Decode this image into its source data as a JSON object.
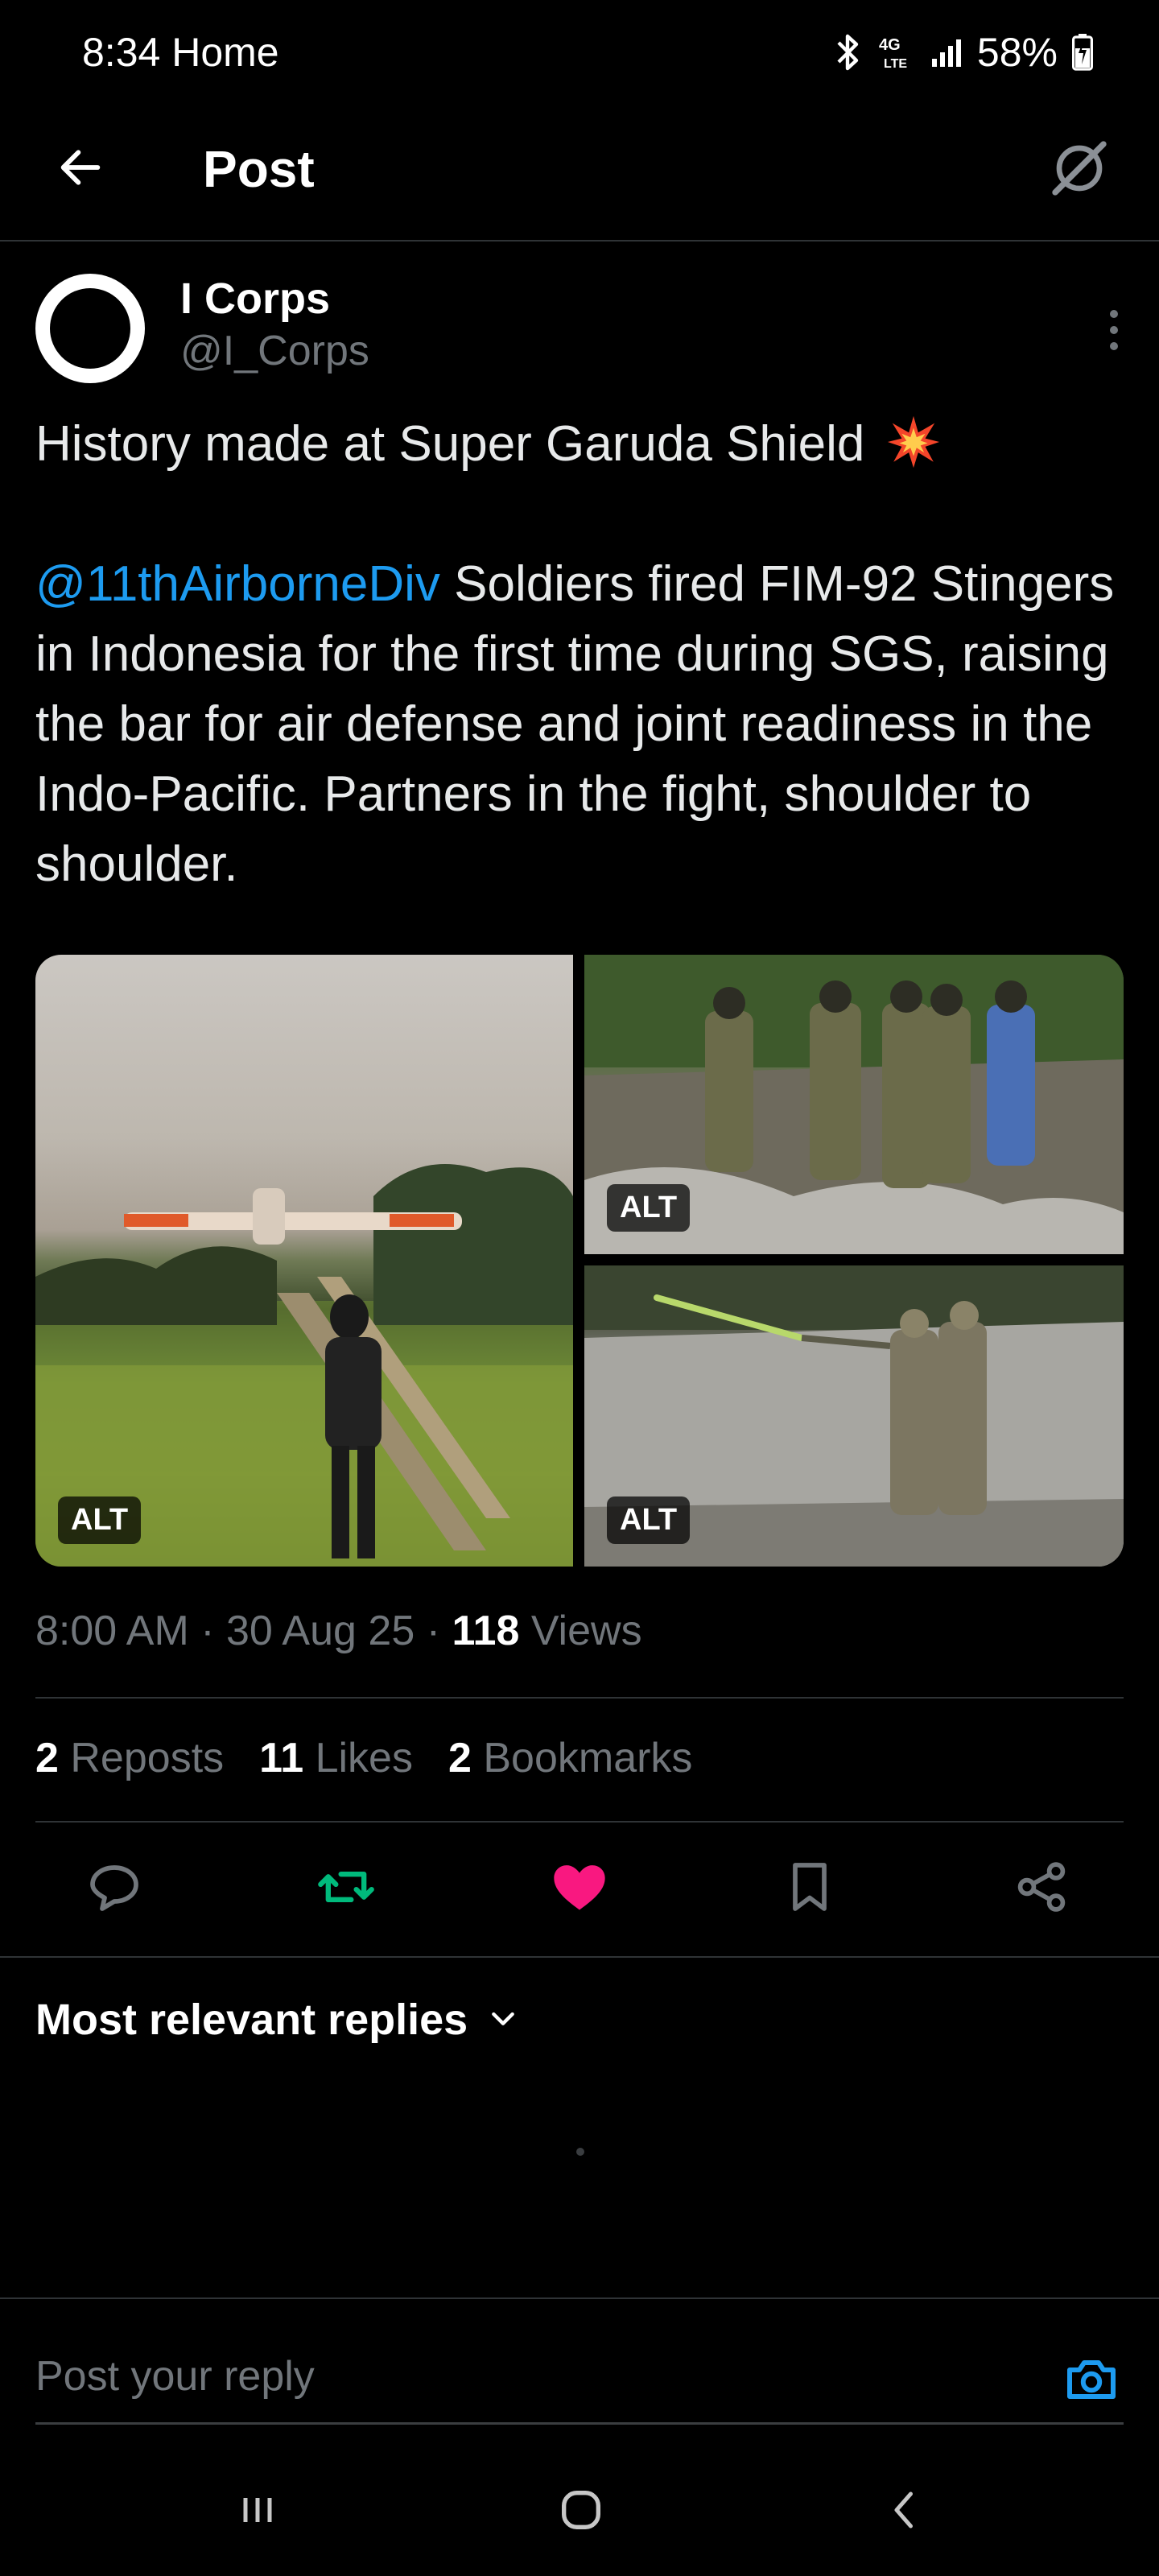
{
  "status_bar": {
    "time": "8:34 Home",
    "network": "4G LTE",
    "battery": "58%"
  },
  "header": {
    "title": "Post",
    "back_icon": "arrow-left-icon",
    "grok_icon": "grok-icon"
  },
  "post": {
    "author_name": "I Corps",
    "author_handle": "@I_Corps",
    "text_line1": "History made at Super Garuda Shield",
    "emoji": "💥",
    "mention": "@11thAirborneDiv",
    "text_body": " Soldiers fired FIM-92 Stingers in Indonesia for the first time during SGS, raising the bar for air defense and joint readiness in the Indo-Pacific. Partners in the fight, shoulder to shoulder.",
    "media": [
      {
        "alt_badge": "ALT"
      },
      {
        "alt_badge": "ALT"
      },
      {
        "alt_badge": "ALT"
      }
    ],
    "time": "8:00 AM",
    "date": "30 Aug 25",
    "views_count": "118",
    "views_label": "Views",
    "reposts_count": "2",
    "reposts_label": "Reposts",
    "likes_count": "11",
    "likes_label": "Likes",
    "bookmarks_count": "2",
    "bookmarks_label": "Bookmarks"
  },
  "colors": {
    "accent": "#1d9bf0",
    "repost": "#00ba7c",
    "like": "#f91880",
    "muted": "#71767b",
    "border": "#2f3336"
  },
  "replies": {
    "sort_label": "Most relevant replies"
  },
  "reply_bar": {
    "placeholder": "Post your reply"
  }
}
